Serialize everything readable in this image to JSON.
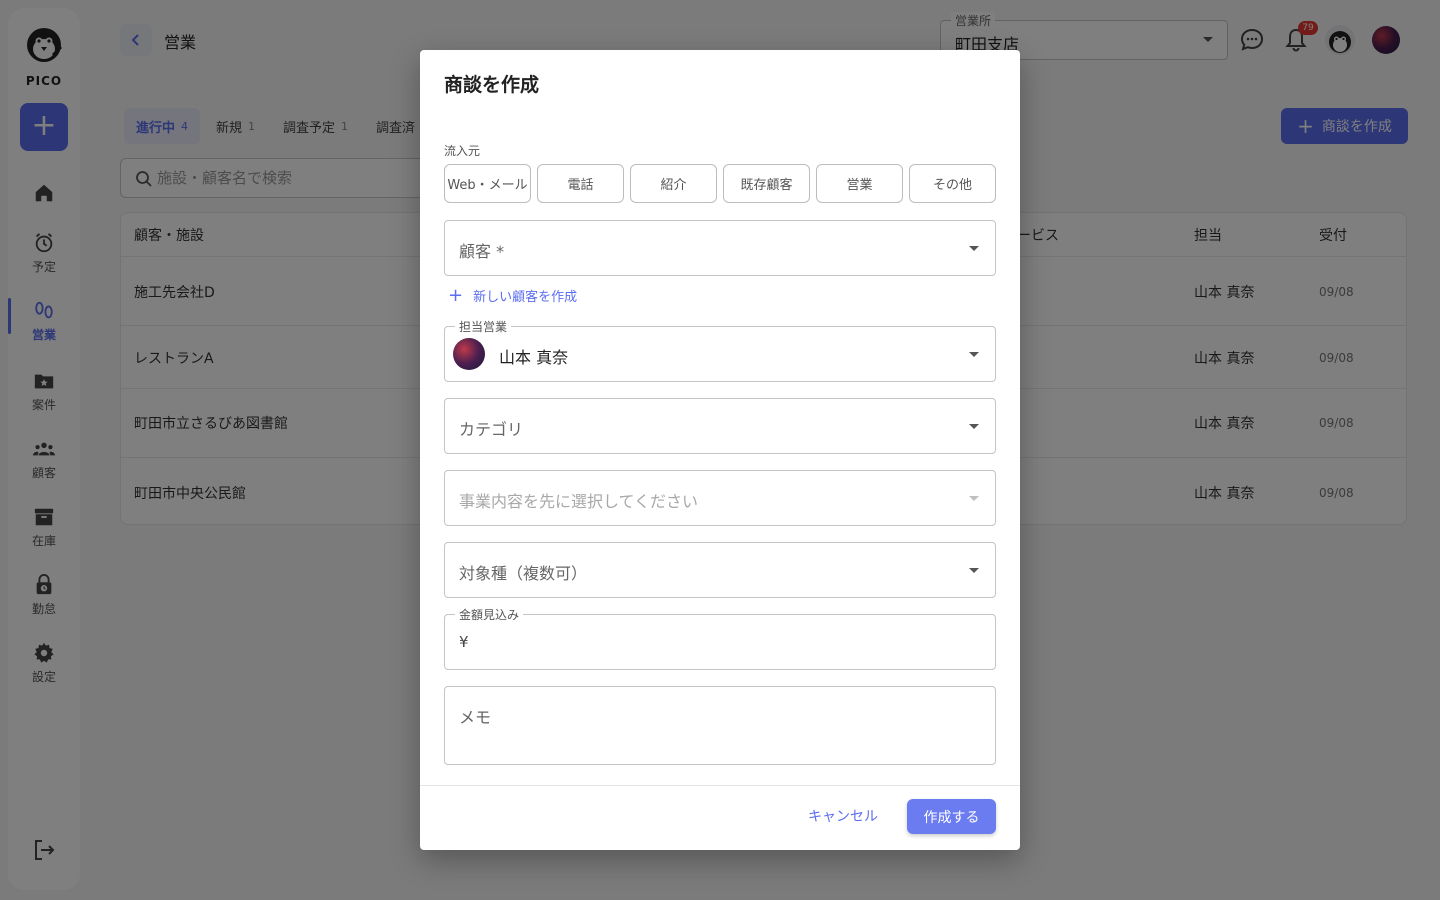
{
  "app": {
    "logo_text": "PICO"
  },
  "sidebar": {
    "add_label": "+",
    "items": [
      {
        "label": "",
        "icon": "home-icon"
      },
      {
        "label": "予定",
        "icon": "alarm-icon"
      },
      {
        "label": "営業",
        "icon": "footprints-icon"
      },
      {
        "label": "案件",
        "icon": "folder-star-icon"
      },
      {
        "label": "顧客",
        "icon": "people-icon"
      },
      {
        "label": "在庫",
        "icon": "archive-icon"
      },
      {
        "label": "勤怠",
        "icon": "lock-clock-icon"
      },
      {
        "label": "設定",
        "icon": "gear-icon"
      }
    ]
  },
  "header": {
    "title": "営業",
    "office_label": "営業所",
    "office_value": "町田支店",
    "notification_count": "79"
  },
  "tabs": [
    {
      "label": "進行中",
      "count": "4"
    },
    {
      "label": "新規",
      "count": "1"
    },
    {
      "label": "調査予定",
      "count": "1"
    },
    {
      "label": "調査済",
      "count": ""
    }
  ],
  "create_button": "商談を作成",
  "search": {
    "placeholder": "施設・顧客名で検索"
  },
  "table": {
    "headers": {
      "customer": "顧客・施設",
      "service": "ービス",
      "staff": "担当",
      "received": "受付"
    },
    "rows": [
      {
        "customer": "施工先会社D",
        "staff": "山本 真奈",
        "date": "09/08"
      },
      {
        "customer": "レストランA",
        "staff": "山本 真奈",
        "date": "09/08"
      },
      {
        "customer": "町田市立さるびあ図書館",
        "staff": "山本 真奈",
        "date": "09/08"
      },
      {
        "customer": "町田市中央公民館",
        "staff": "山本 真奈",
        "date": "09/08"
      }
    ]
  },
  "dialog": {
    "title": "商談を作成",
    "source_label": "流入元",
    "sources": [
      "Web・メール",
      "電話",
      "紹介",
      "既存顧客",
      "営業",
      "その他"
    ],
    "customer_placeholder": "顧客 *",
    "new_customer_link": "新しい顧客を作成",
    "sales_rep_label": "担当営業",
    "sales_rep_value": "山本 真奈",
    "category_placeholder": "カテゴリ",
    "business_placeholder": "事業内容を先に選択してください",
    "target_placeholder": "対象種（複数可）",
    "amount_label": "金額見込み",
    "currency_symbol": "¥",
    "memo_placeholder": "メモ",
    "cancel_label": "キャンセル",
    "submit_label": "作成する"
  },
  "colors": {
    "accent": "#5b6ef0",
    "badge": "#e53935"
  }
}
